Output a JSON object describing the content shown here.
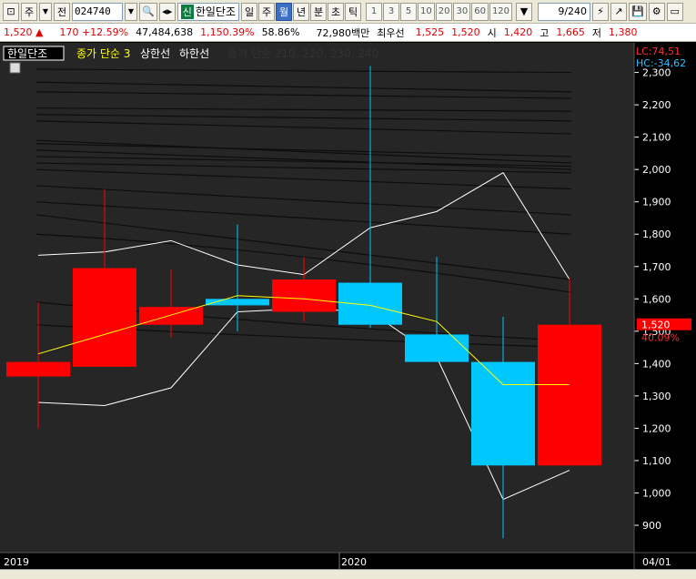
{
  "toolbar": {
    "code": "024740",
    "left_btn1": "주",
    "left_btn2": "전",
    "name_badge": "신",
    "name": "한일단조",
    "periods": [
      "일",
      "주",
      "월",
      "년",
      "분",
      "초",
      "틱"
    ],
    "selected_period": "월",
    "intervals": [
      "1",
      "3",
      "5",
      "10",
      "20",
      "30",
      "60",
      "120"
    ],
    "page": "9/240"
  },
  "info": {
    "price": "1,520",
    "arrow": "▲",
    "change": "170",
    "change_pct": "+12.59%",
    "volume": "47,484,638",
    "vol_pct1": "1,150.39%",
    "vol_pct2": "58.86%",
    "amount": "72,980백만",
    "pref_label": "최우선",
    "ask": "1,525",
    "bid": "1,520",
    "open_label": "시",
    "open": "1,420",
    "high_label": "고",
    "high": "1,665",
    "low_label": "저",
    "low": "1,380"
  },
  "legend": {
    "stock": "한일단조",
    "ma": "종가 단순 3",
    "upper": "상한선",
    "lower": "하한선",
    "ma_long": "종가 단순 210, 220, 230, 240"
  },
  "right_labels": {
    "lc": "LC:74,51",
    "hc": "HC:-34,62",
    "price_tag": "1,520",
    "price_pct": "40.09%"
  },
  "x_labels": {
    "left": "2019",
    "mid": "2020",
    "right": "04/01"
  },
  "colors": {
    "up": "#ff0000",
    "down": "#00c8ff",
    "ma": "#ffff00",
    "band": "#ffffff"
  },
  "chart_data": {
    "type": "candlestick",
    "ylim": [
      850,
      2330
    ],
    "yticks": [
      900,
      1000,
      1100,
      1200,
      1300,
      1400,
      1500,
      1600,
      1700,
      1800,
      1900,
      2000,
      2100,
      2200,
      2300
    ],
    "candles": [
      {
        "open": 1360,
        "close": 1405,
        "high": 1590,
        "low": 1200
      },
      {
        "open": 1390,
        "close": 1695,
        "high": 1940,
        "low": 1390
      },
      {
        "open": 1520,
        "close": 1575,
        "high": 1690,
        "low": 1480
      },
      {
        "open": 1600,
        "close": 1580,
        "high": 1830,
        "low": 1500
      },
      {
        "open": 1560,
        "close": 1660,
        "high": 1730,
        "low": 1530
      },
      {
        "open": 1650,
        "close": 1520,
        "high": 2320,
        "low": 1510
      },
      {
        "open": 1490,
        "close": 1405,
        "high": 1730,
        "low": 1405
      },
      {
        "open": 1405,
        "close": 1085,
        "high": 1545,
        "low": 860
      },
      {
        "open": 1085,
        "close": 1520,
        "high": 1665,
        "low": 1085
      }
    ],
    "ma3": [
      1430,
      1490,
      1550,
      1610,
      1600,
      1580,
      1530,
      1335,
      1335
    ],
    "upper_band": [
      1735,
      1745,
      1780,
      1705,
      1675,
      1820,
      1870,
      1990,
      1660
    ],
    "lower_band": [
      1280,
      1270,
      1325,
      1560,
      1570,
      1560,
      1420,
      980,
      1070
    ]
  }
}
